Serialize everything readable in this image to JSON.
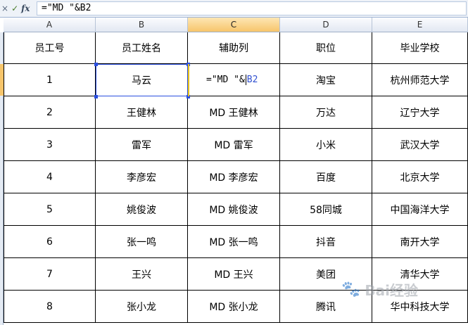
{
  "formula_bar": {
    "cancel_glyph": "×",
    "confirm_glyph": "✓",
    "fx_label": "fx",
    "formula": "=\"MD \"&B2"
  },
  "columns": [
    "A",
    "B",
    "C",
    "D",
    "E"
  ],
  "selected_column": "C",
  "table": {
    "headers": [
      "员工号",
      "员工姓名",
      "辅助列",
      "职位",
      "毕业学校"
    ],
    "rows": [
      [
        "1",
        "马云",
        "",
        "淘宝",
        "杭州师范大学"
      ],
      [
        "2",
        "王健林",
        "MD 王健林",
        "万达",
        "辽宁大学"
      ],
      [
        "3",
        "雷军",
        "MD 雷军",
        "小米",
        "武汉大学"
      ],
      [
        "4",
        "李彦宏",
        "MD 李彦宏",
        "百度",
        "北京大学"
      ],
      [
        "5",
        "姚俊波",
        "MD 姚俊波",
        "58同城",
        "中国海洋大学"
      ],
      [
        "6",
        "张一鸣",
        "MD 张一鸣",
        "抖音",
        "南开大学"
      ],
      [
        "7",
        "王兴",
        "MD 王兴",
        "美团",
        "清华大学"
      ],
      [
        "8",
        "张小龙",
        "MD 张小龙",
        "腾讯",
        "华中科技大学"
      ]
    ]
  },
  "editing_cell": {
    "prefix": "=\"MD \"&",
    "ref": "B2"
  },
  "watermark": {
    "text": "Bai经验"
  },
  "colors": {
    "reference_border": "#2a4fe0",
    "selected_header": "#f7c56b",
    "grid_line": "#000000"
  }
}
